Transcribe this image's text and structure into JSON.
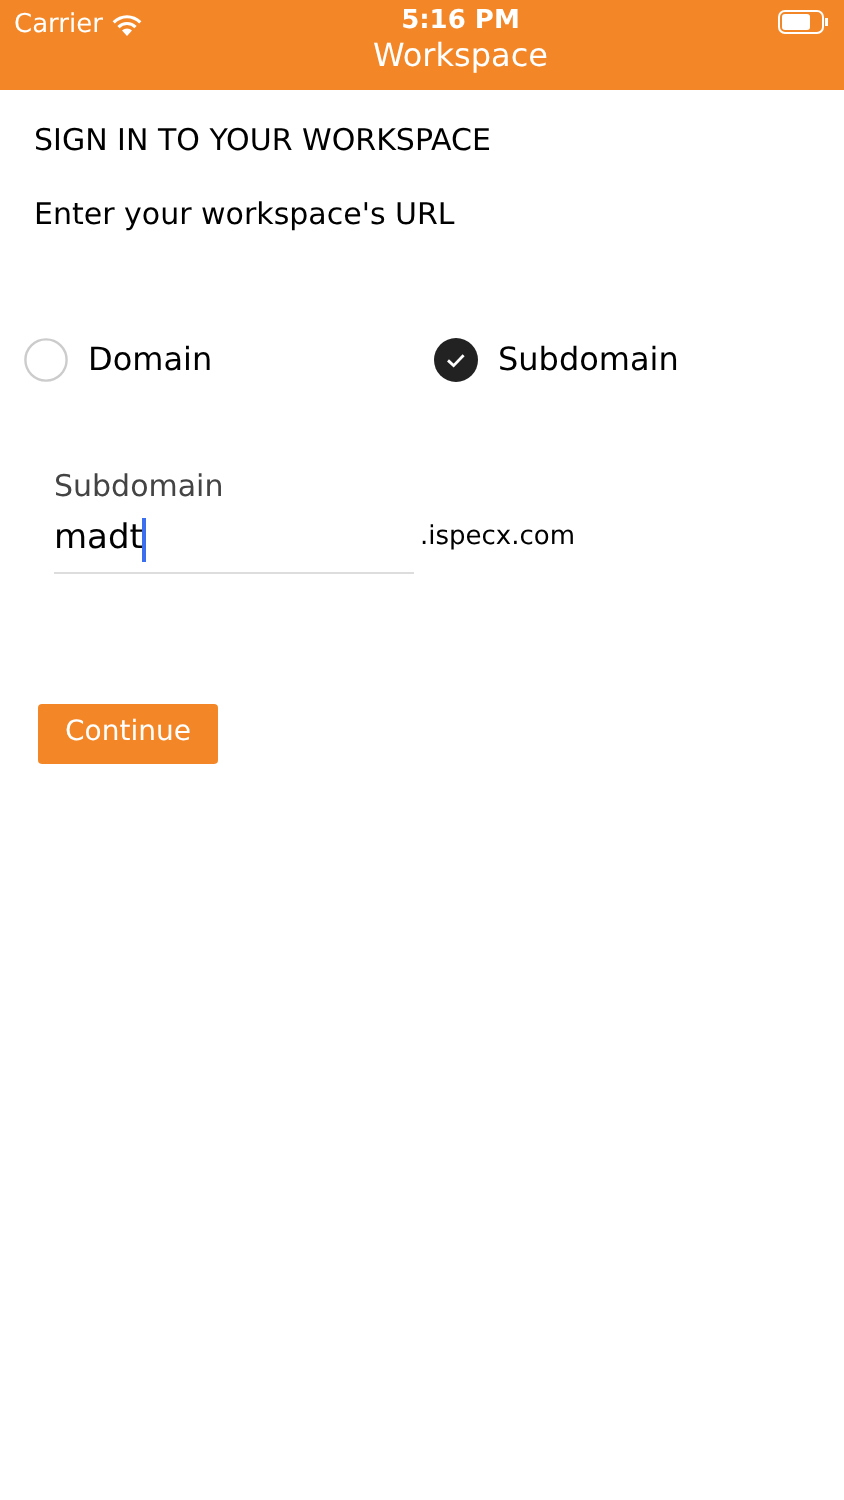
{
  "status_bar": {
    "carrier": "Carrier",
    "time": "5:16 PM"
  },
  "nav": {
    "title": "Workspace"
  },
  "heading": "SIGN IN TO YOUR WORKSPACE",
  "subheading": "Enter your workspace's URL",
  "options": [
    {
      "label": "Domain",
      "selected": false
    },
    {
      "label": "Subdomain",
      "selected": true
    }
  ],
  "field": {
    "label": "Subdomain",
    "value": "madt",
    "suffix": ".ispecx.com"
  },
  "button": "Continue"
}
